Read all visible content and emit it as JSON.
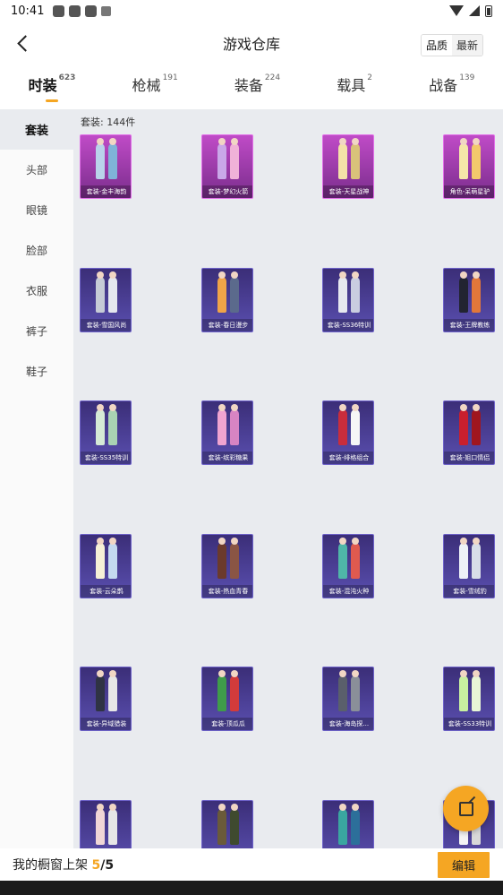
{
  "status": {
    "time": "10:41"
  },
  "header": {
    "title": "游戏仓库",
    "sort": [
      "品质",
      "最新"
    ]
  },
  "tabs": [
    {
      "label": "时装",
      "count": "623"
    },
    {
      "label": "枪械",
      "count": "191"
    },
    {
      "label": "装备",
      "count": "224"
    },
    {
      "label": "载具",
      "count": "2"
    },
    {
      "label": "战备",
      "count": "139"
    }
  ],
  "sidebar": {
    "items": [
      "套装",
      "头部",
      "眼镜",
      "脸部",
      "衣服",
      "裤子",
      "鞋子"
    ]
  },
  "content": {
    "count_label": "套装: 144件",
    "items": [
      {
        "label": "套装-金丰海韵",
        "tier": "legend",
        "colors": [
          "#b9d3ea",
          "#7fb3d8",
          "#d6e7f5"
        ]
      },
      {
        "label": "套装-梦幻火箭",
        "tier": "legend",
        "colors": [
          "#c9a8e8",
          "#f0b2d8",
          "#a8d4f2"
        ]
      },
      {
        "label": "套装-天星战神",
        "tier": "legend",
        "colors": [
          "#f4e2a8",
          "#d9c27a",
          "#eadcb6"
        ]
      },
      {
        "label": "角色-呆萌星驴",
        "tier": "legend",
        "colors": [
          "#f5e7a9",
          "#f3c96c",
          "#fef4d2"
        ]
      },
      {
        "label": "套装-雪国风尚",
        "tier": "epic",
        "colors": [
          "#c6cbd6",
          "#e4e7ee",
          "#9aa0b4"
        ]
      },
      {
        "label": "套装-春日漫步",
        "tier": "epic",
        "colors": [
          "#f0a448",
          "#5b6a8c",
          "#8a94a8"
        ]
      },
      {
        "label": "套装-SS36特训",
        "tier": "epic",
        "colors": [
          "#e6e8ef",
          "#c9cde0",
          "#a9afc5"
        ]
      },
      {
        "label": "套装-王牌教练",
        "tier": "epic",
        "colors": [
          "#222431",
          "#e2773a",
          "#3c3f53"
        ]
      },
      {
        "label": "套装-SS35特训",
        "tier": "epic",
        "colors": [
          "#d5ead6",
          "#a9d2b3",
          "#eef3ee"
        ]
      },
      {
        "label": "套装-缤彩糖果",
        "tier": "epic",
        "colors": [
          "#f0a4d0",
          "#d784c3",
          "#f6c7e2"
        ]
      },
      {
        "label": "套装-绯格组合",
        "tier": "epic",
        "colors": [
          "#c92d3c",
          "#f6f6f6",
          "#b5213a"
        ]
      },
      {
        "label": "套装-姐口情侣",
        "tier": "epic",
        "colors": [
          "#c91f2e",
          "#a0161f",
          "#e4474f"
        ]
      },
      {
        "label": "套装-云朵鹊",
        "tier": "epic",
        "colors": [
          "#f6f1d6",
          "#c4d9ef",
          "#e6e3c4"
        ]
      },
      {
        "label": "套装-热血青春",
        "tier": "epic",
        "colors": [
          "#6b3a2c",
          "#8a5544",
          "#4a2b24"
        ]
      },
      {
        "label": "套装-混沌火种",
        "tier": "epic",
        "colors": [
          "#4fb6a8",
          "#e05a4f",
          "#3a8f9a"
        ]
      },
      {
        "label": "套装-雪绒豹",
        "tier": "epic",
        "colors": [
          "#eef2f7",
          "#d8dde8",
          "#c3cad9"
        ]
      },
      {
        "label": "套装-异域猎装",
        "tier": "epic",
        "colors": [
          "#2f3344",
          "#e6e6e6",
          "#404658"
        ]
      },
      {
        "label": "套装-顶瓜瓜",
        "tier": "epic",
        "colors": [
          "#3f9c4a",
          "#d23b3b",
          "#2f7a39"
        ]
      },
      {
        "label": "套装-海岛探...",
        "tier": "epic",
        "colors": [
          "#5a5f6b",
          "#8a8f99",
          "#3d414b"
        ]
      },
      {
        "label": "套装-SS33特训",
        "tier": "epic",
        "colors": [
          "#c8f0a0",
          "#e8f6d6",
          "#a6dc78"
        ]
      },
      {
        "label": "",
        "tier": "epic",
        "colors": [
          "#f0d6d6",
          "#e6e6e6",
          "#d2a3a3"
        ]
      },
      {
        "label": "",
        "tier": "epic",
        "colors": [
          "#6a5a3a",
          "#3f4a2f",
          "#8a7a52"
        ]
      },
      {
        "label": "",
        "tier": "epic",
        "colors": [
          "#3aa6a0",
          "#2c6f9a",
          "#55c0b6"
        ]
      },
      {
        "label": "",
        "tier": "epic",
        "colors": [
          "#f4f4f4",
          "#d8d8d8",
          "#c2c2c2"
        ]
      }
    ]
  },
  "bottom": {
    "prefix": "我的橱窗上架 ",
    "current": "5",
    "sep": "/",
    "total": "5",
    "edit": "编辑"
  },
  "colors": {
    "accent": "#f5a623",
    "legend": "#c04bc7",
    "epic": "#4a3e96"
  },
  "icons": {
    "back": "back-arrow-icon",
    "share": "share-external-icon"
  }
}
